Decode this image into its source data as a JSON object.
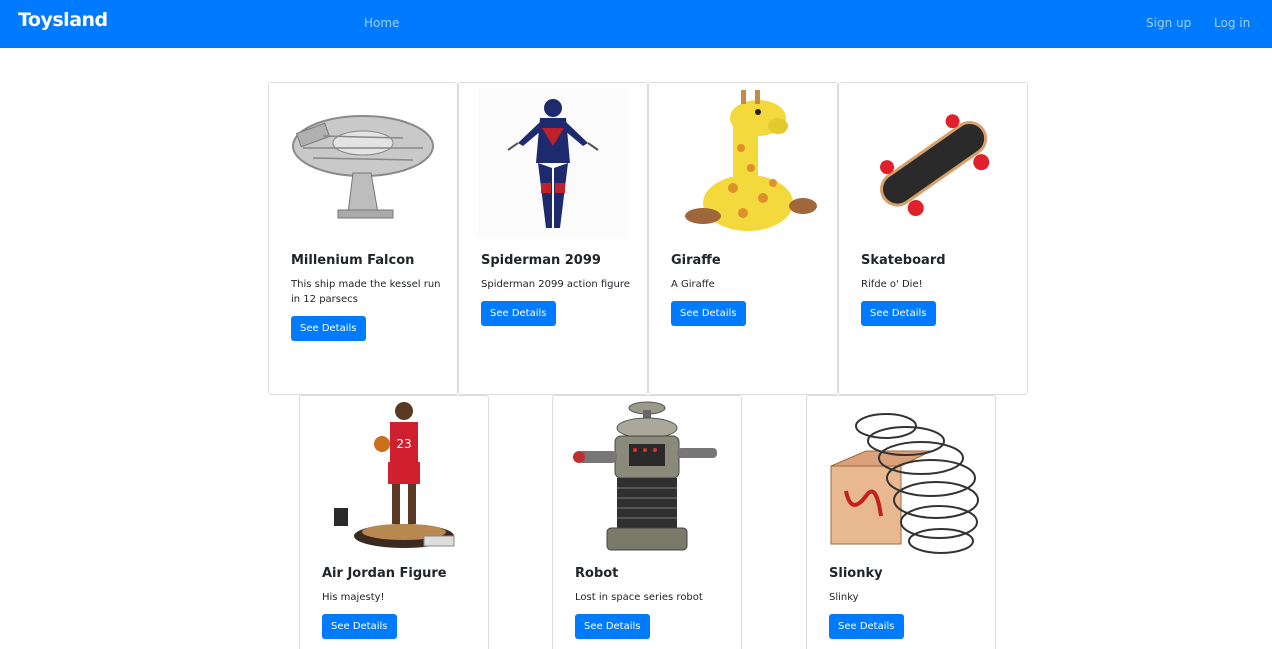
{
  "navbar": {
    "brand": "Toysland",
    "links": {
      "home": "Home",
      "signup": "Sign up",
      "login": "Log in"
    }
  },
  "products": [
    {
      "title": "Millenium Falcon",
      "description": "This ship made the kessel run in 12 parsecs",
      "button": "See Details",
      "image": "millennium-falcon-model"
    },
    {
      "title": "Spiderman 2099",
      "description": "Spiderman 2099 action figure",
      "button": "See Details",
      "image": "spiderman-figure"
    },
    {
      "title": "Giraffe",
      "description": "A Giraffe",
      "button": "See Details",
      "image": "giraffe-plush"
    },
    {
      "title": "Skateboard",
      "description": "Rifde o' Die!",
      "button": "See Details",
      "image": "skateboard"
    },
    {
      "title": "Air Jordan Figure",
      "description": "His majesty!",
      "button": "See Details",
      "image": "basketball-figure"
    },
    {
      "title": "Robot",
      "description": "Lost in space series robot",
      "button": "See Details",
      "image": "robot"
    },
    {
      "title": "Slionky",
      "description": "Slinky",
      "button": "See Details",
      "image": "slinky"
    }
  ],
  "colors": {
    "primary": "#007bff",
    "text": "#212529",
    "border": "#dcdcdc"
  }
}
